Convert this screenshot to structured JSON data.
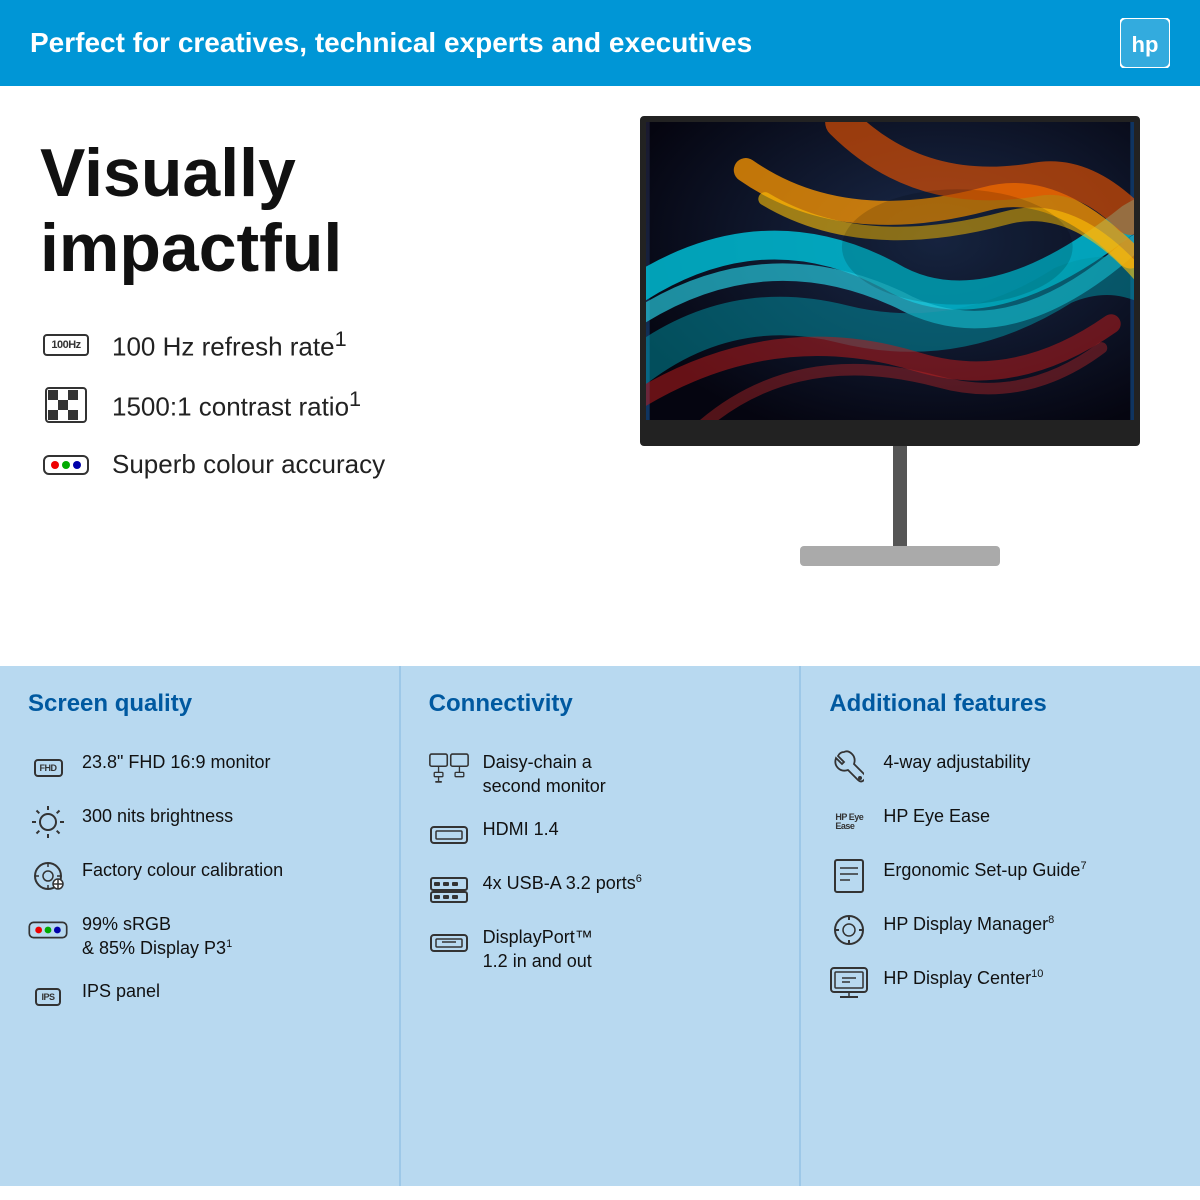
{
  "header": {
    "tagline": "Perfect for creatives, technical experts and executives",
    "logo_alt": "HP Logo"
  },
  "hero": {
    "title": "Visually impactful",
    "features": [
      {
        "id": "refresh",
        "icon": "hz-icon",
        "text": "100 Hz refresh rate",
        "sup": "1"
      },
      {
        "id": "contrast",
        "icon": "contrast-icon",
        "text": "1500:1 contrast ratio",
        "sup": "1"
      },
      {
        "id": "colour",
        "icon": "colour-icon",
        "text": "Superb colour accuracy",
        "sup": ""
      }
    ]
  },
  "bottom": {
    "screen_quality": {
      "heading": "Screen quality",
      "items": [
        {
          "id": "fhd",
          "icon": "fhd-icon",
          "text": "23.8\" FHD 16:9 monitor",
          "sup": ""
        },
        {
          "id": "brightness",
          "icon": "brightness-icon",
          "text": "300 nits brightness",
          "sup": ""
        },
        {
          "id": "calibration",
          "icon": "calibration-icon",
          "text": "Factory colour calibration",
          "sup": ""
        },
        {
          "id": "srgb",
          "icon": "srgb-icon",
          "text": "99% sRGB & 85% Display P3",
          "sup": "1"
        },
        {
          "id": "ips",
          "icon": "ips-icon",
          "text": "IPS panel",
          "sup": ""
        }
      ]
    },
    "connectivity": {
      "heading": "Connectivity",
      "items": [
        {
          "id": "daisy",
          "icon": "daisy-icon",
          "text": "Daisy-chain a second monitor",
          "sup": ""
        },
        {
          "id": "hdmi",
          "icon": "hdmi-icon",
          "text": "HDMI 1.4",
          "sup": ""
        },
        {
          "id": "usb",
          "icon": "usb-icon",
          "text": "4x USB-A 3.2 ports",
          "sup": "6"
        },
        {
          "id": "dp",
          "icon": "dp-icon",
          "text": "DisplayPort™ 1.2 in and out",
          "sup": ""
        }
      ]
    },
    "additional": {
      "heading": "Additional features",
      "items": [
        {
          "id": "adjust",
          "icon": "adjust-icon",
          "text": "4-way adjustability",
          "sup": ""
        },
        {
          "id": "eyeease",
          "icon": "eyeease-icon",
          "text": "HP Eye Ease",
          "sup": ""
        },
        {
          "id": "guide",
          "icon": "guide-icon",
          "text": "Ergonomic Set-up Guide",
          "sup": "7"
        },
        {
          "id": "display-mgr",
          "icon": "display-mgr-icon",
          "text": "HP Display Manager",
          "sup": "8"
        },
        {
          "id": "display-ctr",
          "icon": "display-ctr-icon",
          "text": "HP Display Center",
          "sup": "10"
        }
      ]
    }
  }
}
